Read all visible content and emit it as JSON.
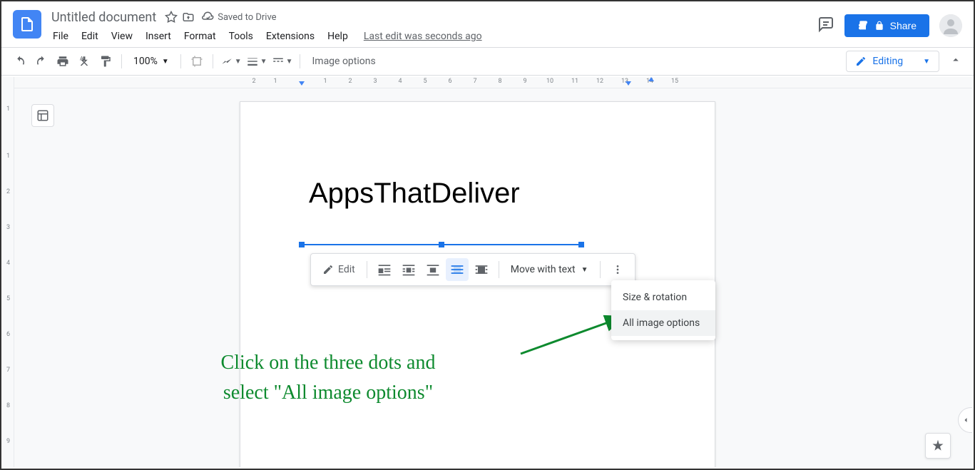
{
  "header": {
    "doc_title": "Untitled document",
    "save_status": "Saved to Drive",
    "last_edit": "Last edit was seconds ago",
    "share_label": "Share"
  },
  "menubar": {
    "items": [
      "File",
      "Edit",
      "View",
      "Insert",
      "Format",
      "Tools",
      "Extensions",
      "Help"
    ]
  },
  "toolbar": {
    "zoom": "100%",
    "image_options": "Image options",
    "editing_mode": "Editing"
  },
  "document": {
    "heading": "AppsThatDeliver"
  },
  "image_toolbar": {
    "edit_label": "Edit",
    "move_label": "Move with text"
  },
  "context_menu": {
    "items": [
      "Size & rotation",
      "All image options"
    ],
    "highlighted_index": 1
  },
  "annotation": {
    "line1": "Click on the three dots and",
    "line2": "select \"All image options\""
  },
  "ruler": {
    "h_numbers": [
      2,
      1,
      1,
      2,
      3,
      4,
      5,
      6,
      7,
      8,
      9,
      10,
      11,
      12,
      13,
      14,
      15
    ],
    "v_numbers": [
      1,
      1,
      2,
      3,
      4,
      5,
      6,
      7,
      8,
      9
    ]
  }
}
